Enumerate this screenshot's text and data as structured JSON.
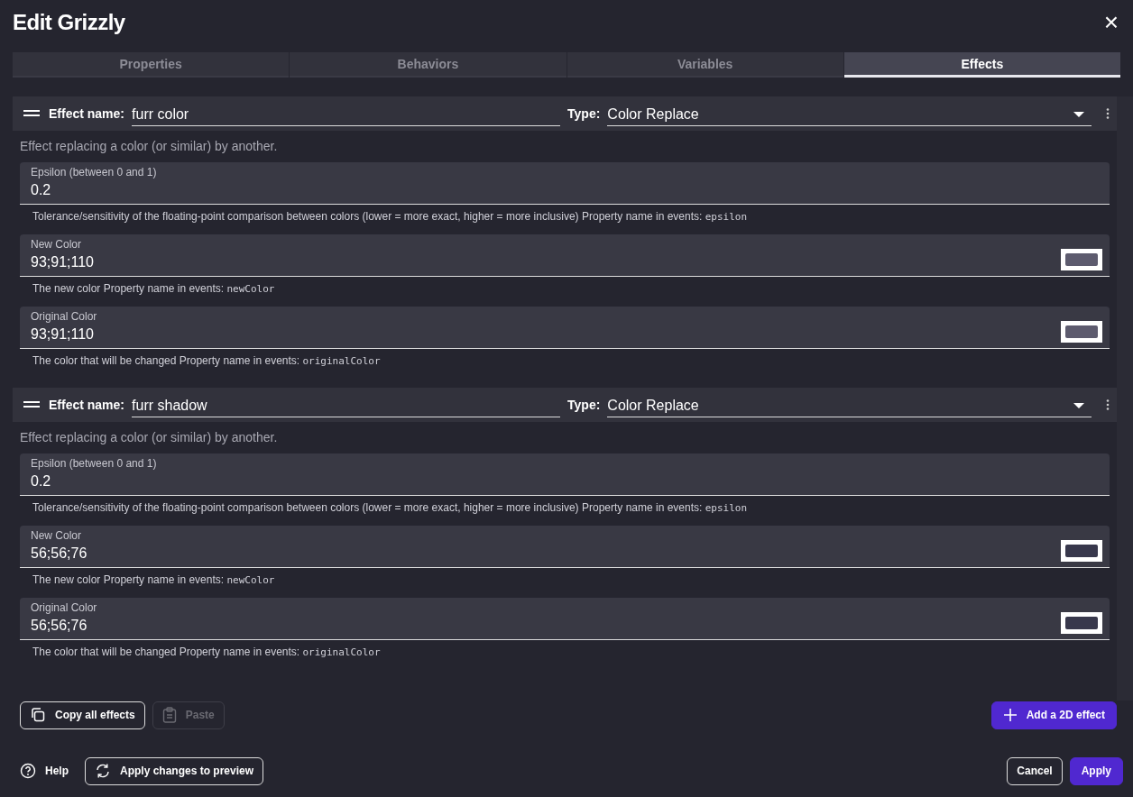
{
  "window": {
    "title": "Edit Grizzly",
    "close_symbol": "×"
  },
  "tabs": [
    {
      "label": "Properties",
      "selected": false
    },
    {
      "label": "Behaviors",
      "selected": false
    },
    {
      "label": "Variables",
      "selected": false
    },
    {
      "label": "Effects",
      "selected": true
    }
  ],
  "effects": [
    {
      "name_label": "Effect name:",
      "name": "furr color",
      "type_label": "Type:",
      "type": "Color Replace",
      "description": "Effect replacing a color (or similar) by another.",
      "params": [
        {
          "kind": "text",
          "label": "Epsilon (between 0 and 1)",
          "value": "0.2",
          "help": "Tolerance/sensitivity of the floating-point comparison between colors (lower = more exact, higher = more inclusive) Property name in events: ",
          "property": "epsilon"
        },
        {
          "kind": "color",
          "label": "New Color",
          "value": "93;91;110",
          "color": "#5d5b6e",
          "help": "The new color Property name in events: ",
          "property": "newColor"
        },
        {
          "kind": "color",
          "label": "Original Color",
          "value": "93;91;110",
          "color": "#5d5b6e",
          "help": "The color that will be changed Property name in events: ",
          "property": "originalColor"
        }
      ]
    },
    {
      "name_label": "Effect name:",
      "name": "furr shadow",
      "type_label": "Type:",
      "type": "Color Replace",
      "description": "Effect replacing a color (or similar) by another.",
      "params": [
        {
          "kind": "text",
          "label": "Epsilon (between 0 and 1)",
          "value": "0.2",
          "help": "Tolerance/sensitivity of the floating-point comparison between colors (lower = more exact, higher = more inclusive) Property name in events: ",
          "property": "epsilon"
        },
        {
          "kind": "color",
          "label": "New Color",
          "value": "56;56;76",
          "color": "#38384c",
          "help": "The new color Property name in events: ",
          "property": "newColor"
        },
        {
          "kind": "color",
          "label": "Original Color",
          "value": "56;56;76",
          "color": "#38384c",
          "help": "The color that will be changed Property name in events: ",
          "property": "originalColor"
        }
      ]
    }
  ],
  "effect_actions": {
    "copy": {
      "label": "Copy all effects",
      "disabled": false
    },
    "paste": {
      "label": "Paste",
      "disabled": true
    },
    "add": {
      "label": "Add a 2D effect",
      "disabled": false
    }
  },
  "footer": {
    "help": "Help",
    "preview": "Apply changes to preview",
    "cancel": "Cancel",
    "apply": "Apply"
  }
}
